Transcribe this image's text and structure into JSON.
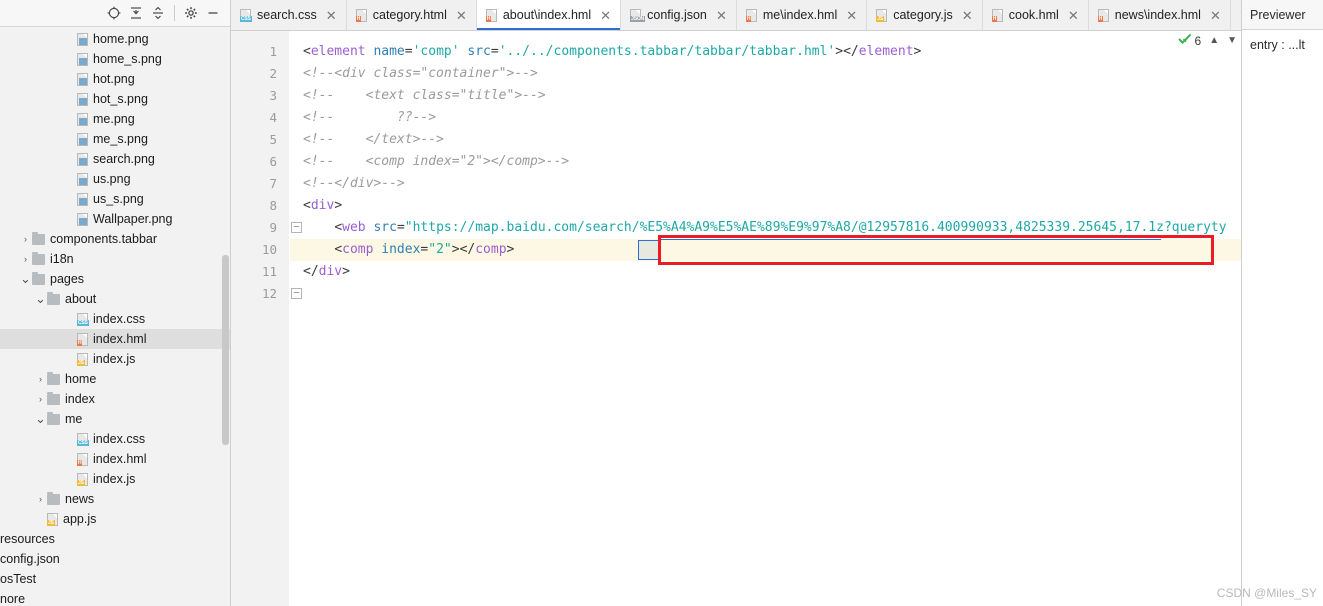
{
  "sidebar": {
    "toolbar": {
      "locate_icon": "target-locate-icon",
      "collapse_icon": "collapse-all-icon",
      "expand_icon": "expand-all-icon",
      "settings_icon": "gear-icon",
      "minimize_icon": "minimize-icon"
    },
    "tree": [
      {
        "label": "home.png",
        "type": "file",
        "kind": "img",
        "indent": 4,
        "chev": "",
        "selected": false
      },
      {
        "label": "home_s.png",
        "type": "file",
        "kind": "img",
        "indent": 4,
        "chev": "",
        "selected": false
      },
      {
        "label": "hot.png",
        "type": "file",
        "kind": "img",
        "indent": 4,
        "chev": "",
        "selected": false
      },
      {
        "label": "hot_s.png",
        "type": "file",
        "kind": "img",
        "indent": 4,
        "chev": "",
        "selected": false
      },
      {
        "label": "me.png",
        "type": "file",
        "kind": "img",
        "indent": 4,
        "chev": "",
        "selected": false
      },
      {
        "label": "me_s.png",
        "type": "file",
        "kind": "img",
        "indent": 4,
        "chev": "",
        "selected": false
      },
      {
        "label": "search.png",
        "type": "file",
        "kind": "img",
        "indent": 4,
        "chev": "",
        "selected": false
      },
      {
        "label": "us.png",
        "type": "file",
        "kind": "img",
        "indent": 4,
        "chev": "",
        "selected": false
      },
      {
        "label": "us_s.png",
        "type": "file",
        "kind": "img",
        "indent": 4,
        "chev": "",
        "selected": false
      },
      {
        "label": "Wallpaper.png",
        "type": "file",
        "kind": "img",
        "indent": 4,
        "chev": "",
        "selected": false
      },
      {
        "label": "components.tabbar",
        "type": "folder",
        "kind": "",
        "indent": 1,
        "chev": ">",
        "selected": false
      },
      {
        "label": "i18n",
        "type": "folder",
        "kind": "",
        "indent": 1,
        "chev": ">",
        "selected": false
      },
      {
        "label": "pages",
        "type": "folder",
        "kind": "",
        "indent": 1,
        "chev": "v",
        "selected": false
      },
      {
        "label": "about",
        "type": "folder",
        "kind": "",
        "indent": 2,
        "chev": "v",
        "selected": false
      },
      {
        "label": "index.css",
        "type": "file",
        "kind": "css",
        "indent": 4,
        "chev": "",
        "selected": false
      },
      {
        "label": "index.hml",
        "type": "file",
        "kind": "h",
        "indent": 4,
        "chev": "",
        "selected": true
      },
      {
        "label": "index.js",
        "type": "file",
        "kind": "js",
        "indent": 4,
        "chev": "",
        "selected": false
      },
      {
        "label": "home",
        "type": "folder",
        "kind": "",
        "indent": 2,
        "chev": ">",
        "selected": false
      },
      {
        "label": "index",
        "type": "folder",
        "kind": "",
        "indent": 2,
        "chev": ">",
        "selected": false
      },
      {
        "label": "me",
        "type": "folder",
        "kind": "",
        "indent": 2,
        "chev": "v",
        "selected": false
      },
      {
        "label": "index.css",
        "type": "file",
        "kind": "css",
        "indent": 4,
        "chev": "",
        "selected": false
      },
      {
        "label": "index.hml",
        "type": "file",
        "kind": "h",
        "indent": 4,
        "chev": "",
        "selected": false
      },
      {
        "label": "index.js",
        "type": "file",
        "kind": "js",
        "indent": 4,
        "chev": "",
        "selected": false
      },
      {
        "label": "news",
        "type": "folder",
        "kind": "",
        "indent": 2,
        "chev": ">",
        "selected": false
      },
      {
        "label": "app.js",
        "type": "file",
        "kind": "js",
        "indent": 2,
        "chev": "",
        "selected": false
      }
    ],
    "tree_clipped": [
      {
        "label": "resources"
      },
      {
        "label": "config.json"
      },
      {
        "label": "osTest"
      },
      {
        "label": "nore"
      }
    ]
  },
  "tabs": [
    {
      "label": "search.css",
      "kind": "css",
      "active": false
    },
    {
      "label": "category.html",
      "kind": "h",
      "active": false
    },
    {
      "label": "about\\index.hml",
      "kind": "h",
      "active": true
    },
    {
      "label": "config.json",
      "kind": "json",
      "active": false
    },
    {
      "label": "me\\index.hml",
      "kind": "h",
      "active": false
    },
    {
      "label": "category.js",
      "kind": "js",
      "active": false
    },
    {
      "label": "cook.hml",
      "kind": "h",
      "active": false
    },
    {
      "label": "news\\index.hml",
      "kind": "h",
      "active": false
    }
  ],
  "tab_overflow_icon": "chevron-down-icon",
  "editor": {
    "line_numbers": [
      "1",
      "2",
      "3",
      "4",
      "5",
      "6",
      "7",
      "8",
      "9",
      "10",
      "11",
      "12"
    ],
    "lines": [
      {
        "n": 1,
        "text": "<element name='comp' src='../../components.tabbar/tabbar/tabbar.hml'></element>"
      },
      {
        "n": 2,
        "text": "<!--<div class=\"container\">-->"
      },
      {
        "n": 3,
        "text": "<!--    <text class=\"title\">-->"
      },
      {
        "n": 4,
        "text": "<!--        ??-->"
      },
      {
        "n": 5,
        "text": "<!--    </text>-->"
      },
      {
        "n": 6,
        "text": "<!--    <comp index=\"2\"></comp>-->"
      },
      {
        "n": 7,
        "text": "<!--</div>-->"
      },
      {
        "n": 8,
        "text": "<div>"
      },
      {
        "n": 9,
        "text": "    <web src=\"https://map.baidu.com/search/%E5%A4%A9%E5%AE%89%E9%97%A8/@12957816.400990933,4825339.25645,17.1z?queryty"
      },
      {
        "n": 10,
        "text": "    <comp index=\"2\"></comp>"
      },
      {
        "n": 11,
        "text": "</div>"
      },
      {
        "n": 12,
        "text": ""
      }
    ],
    "url_value": "https://map.baidu.com/search/%E5%A4%A9%E5%AE%89%E9%97%A8/@12957816.400990933,4825339.25645,17.1z?queryty",
    "highlight_color": "#ec1c24",
    "active_line": 9,
    "status": {
      "check_icon": "check-mark-icon",
      "count": "6",
      "prev_icon": "chevron-up-icon",
      "next_icon": "chevron-down-icon"
    }
  },
  "previewer": {
    "title": "Previewer",
    "entry": "entry : ...lt"
  },
  "watermark": "CSDN @Miles_SY"
}
